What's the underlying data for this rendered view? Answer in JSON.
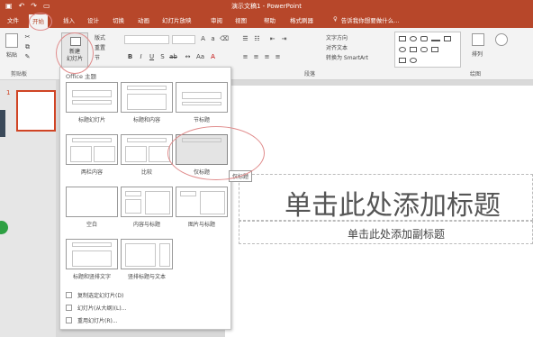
{
  "window": {
    "title": "演示文稿1 - PowerPoint",
    "qat_icons": [
      "save-icon",
      "undo-icon",
      "redo-icon",
      "slideshow-icon"
    ]
  },
  "tabs": [
    {
      "label": "文件",
      "active": false
    },
    {
      "label": "开始",
      "active": true
    },
    {
      "label": "插入",
      "active": false
    },
    {
      "label": "设计",
      "active": false
    },
    {
      "label": "切换",
      "active": false
    },
    {
      "label": "动画",
      "active": false
    },
    {
      "label": "幻灯片放映",
      "active": false
    },
    {
      "label": "审阅",
      "active": false
    },
    {
      "label": "视图",
      "active": false
    },
    {
      "label": "帮助",
      "active": false
    },
    {
      "label": "格式刷器",
      "active": false
    }
  ],
  "tellme": {
    "icon": "lightbulb-icon",
    "text": "告诉我你想要做什么..."
  },
  "ribbon": {
    "clipboard": {
      "paste_label": "粘贴",
      "group_label": "剪贴板"
    },
    "slides": {
      "new_slide_label": "新建\n幻灯片",
      "layout_label": "版式",
      "reset_label": "重置",
      "section_label": "节"
    },
    "paragraph": {
      "text_direction": "文字方向",
      "align_text": "对齐文本",
      "smartart": "转换为 SmartArt",
      "group_label": "段落"
    },
    "drawing": {
      "arrange_label": "排列",
      "group_label": "绘图"
    }
  },
  "thumbnail": {
    "number": "1"
  },
  "slide": {
    "title_placeholder": "单击此处添加标题",
    "subtitle_placeholder": "单击此处添加副标题"
  },
  "layout_dropdown": {
    "header": "Office 主题",
    "layouts": [
      {
        "name": "标题幻灯片"
      },
      {
        "name": "标题和内容"
      },
      {
        "name": "节标题"
      },
      {
        "name": "两栏内容"
      },
      {
        "name": "比较"
      },
      {
        "name": "仅标题"
      },
      {
        "name": "空白"
      },
      {
        "name": "内容与标题"
      },
      {
        "name": "图片与标题"
      },
      {
        "name": "标题和竖排文字"
      },
      {
        "name": "竖排标题与文本"
      }
    ],
    "selected": "仅标题",
    "tooltip": "仅标题",
    "commands": [
      {
        "label": "复制选定幻灯片(D)",
        "icon": "duplicate-icon"
      },
      {
        "label": "幻灯片(从大纲)(L)...",
        "icon": "outline-icon"
      },
      {
        "label": "重用幻灯片(R)...",
        "icon": "reuse-icon"
      }
    ]
  }
}
